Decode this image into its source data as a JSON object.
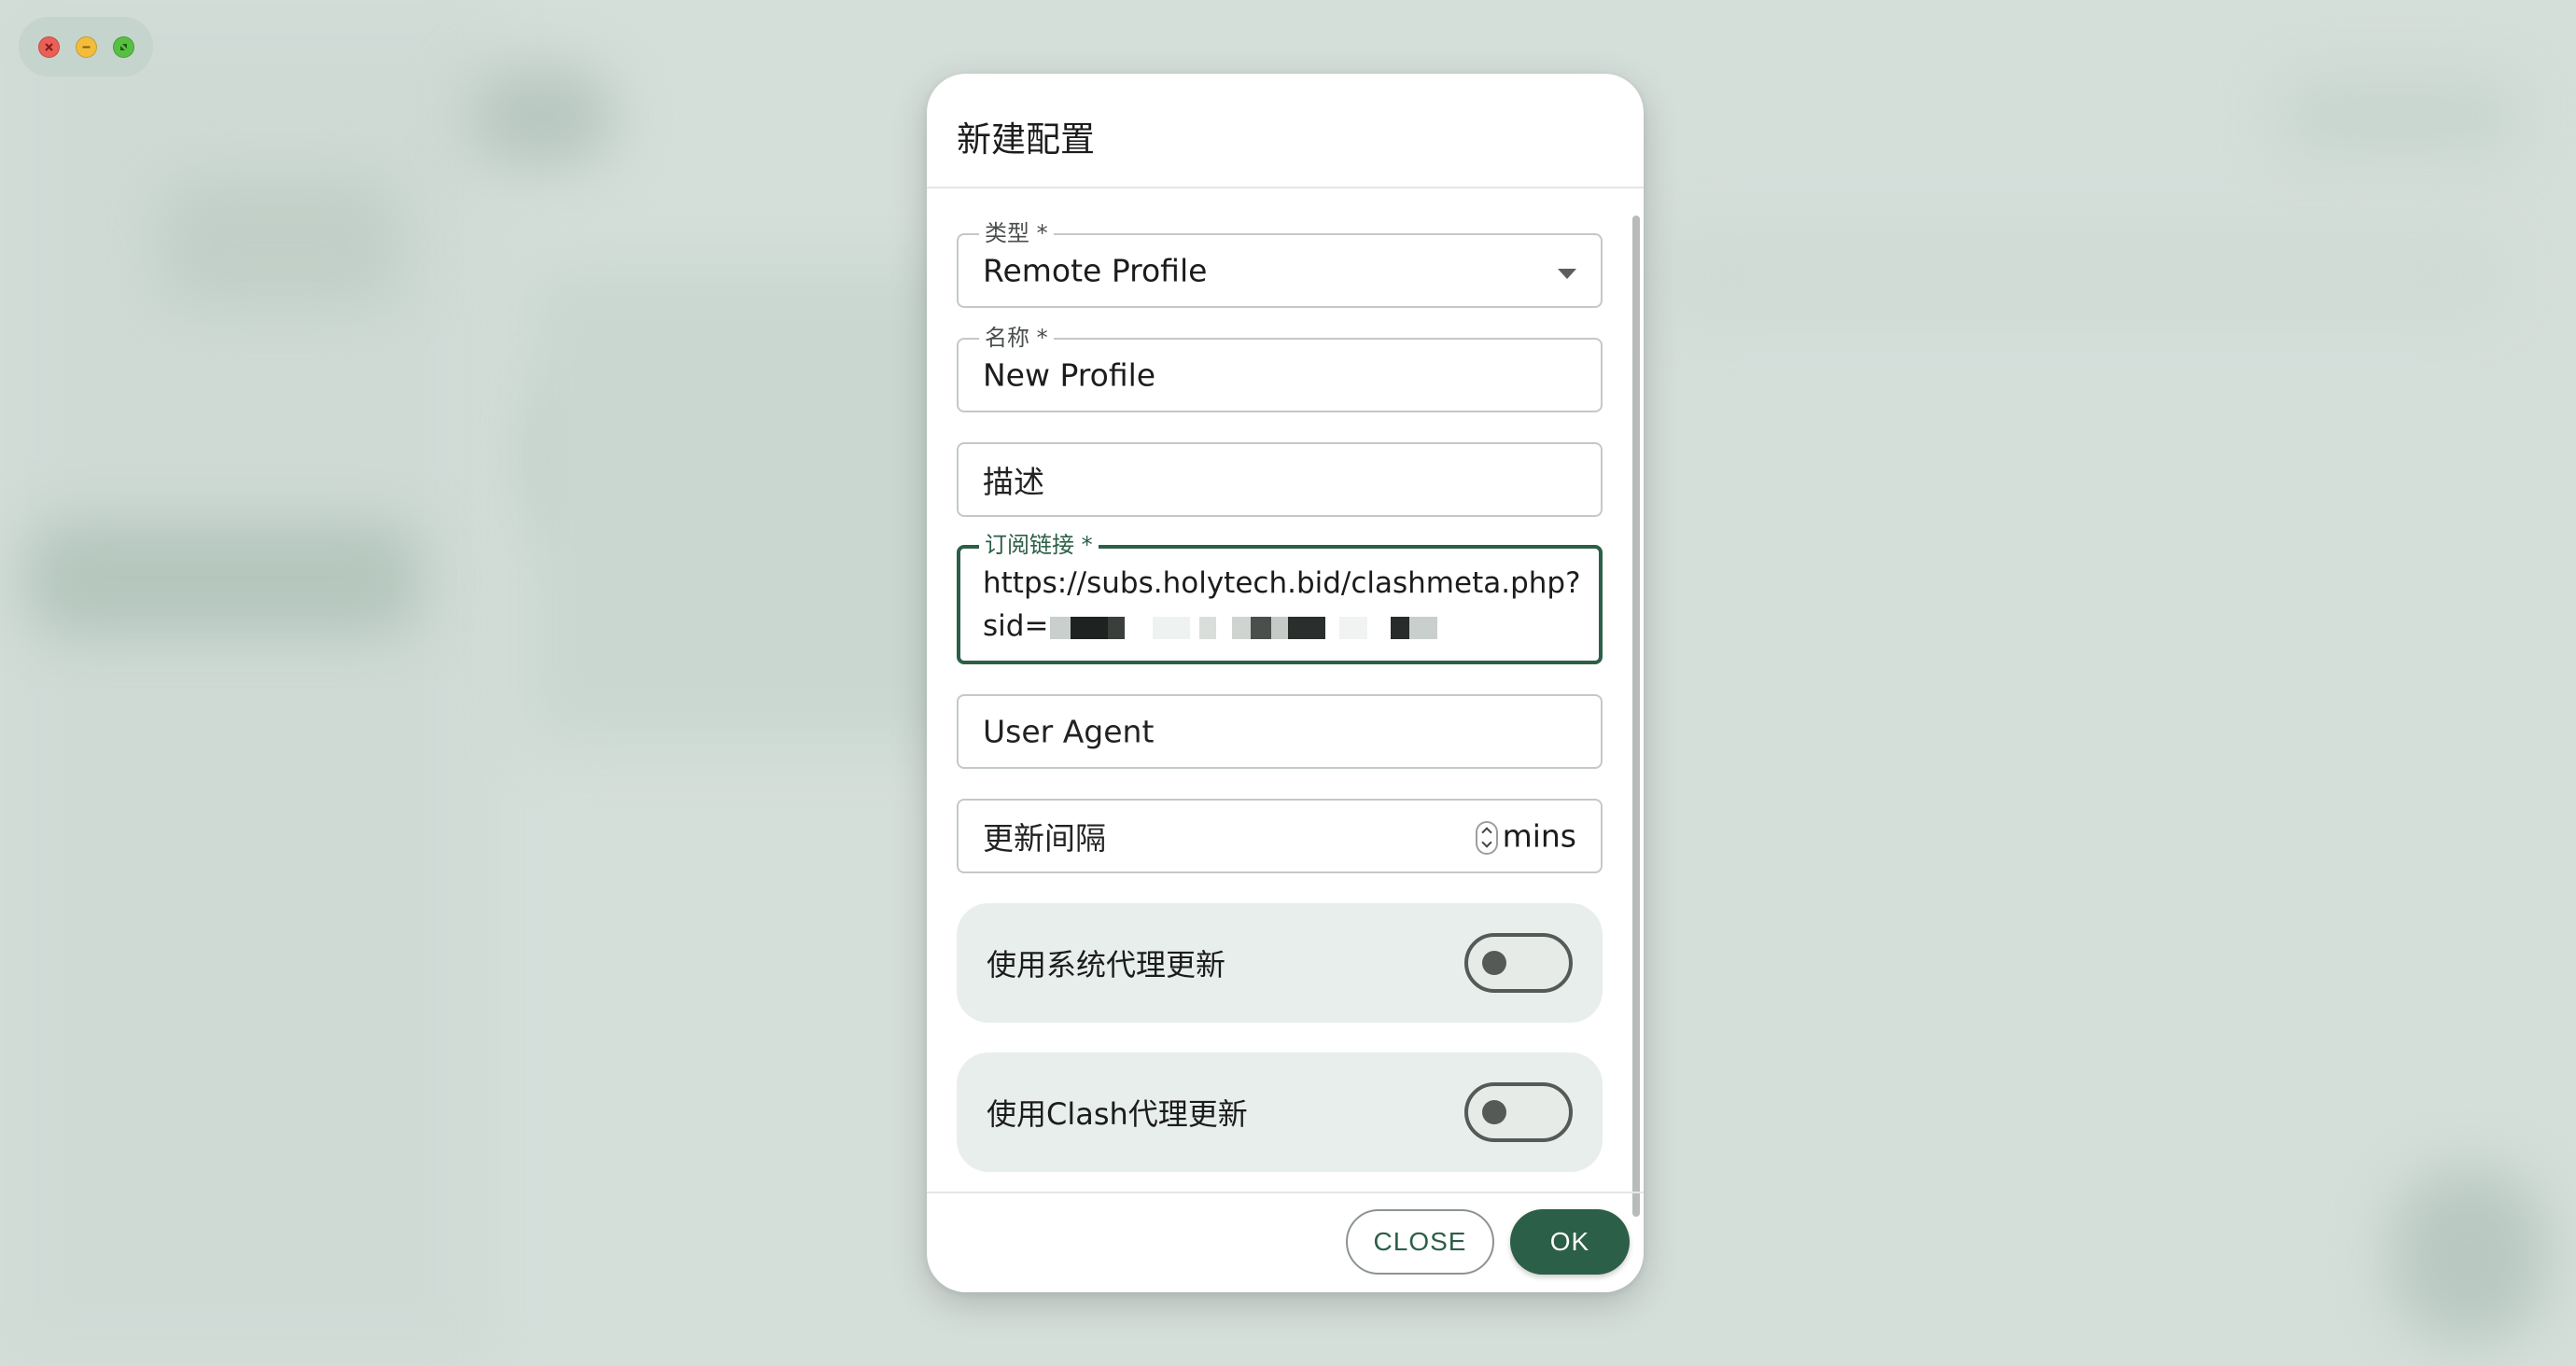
{
  "window_controls": {
    "close_color": "#ec5f56",
    "minimize_color": "#f2bd3c",
    "maximize_color": "#58c041"
  },
  "dialog": {
    "title": "新建配置",
    "fields": {
      "type": {
        "label": "类型 *",
        "value": "Remote Profile"
      },
      "name": {
        "label": "名称 *",
        "value": "New Profile"
      },
      "description": {
        "placeholder": "描述"
      },
      "subscription_url": {
        "label": "订阅链接 *",
        "line1": "https://subs.holytech.bid/clashmeta.php?",
        "line2_prefix": "sid="
      },
      "user_agent": {
        "placeholder": "User Agent"
      },
      "update_interval": {
        "placeholder": "更新间隔",
        "suffix": "mins"
      }
    },
    "switches": {
      "system_proxy": {
        "label": "使用系统代理更新",
        "on": false
      },
      "clash_proxy": {
        "label": "使用Clash代理更新",
        "on": false
      }
    },
    "buttons": {
      "close": "CLOSE",
      "ok": "OK"
    }
  },
  "colors": {
    "accent": "#2c5f47",
    "switch_row_bg": "#e8eeeb"
  }
}
